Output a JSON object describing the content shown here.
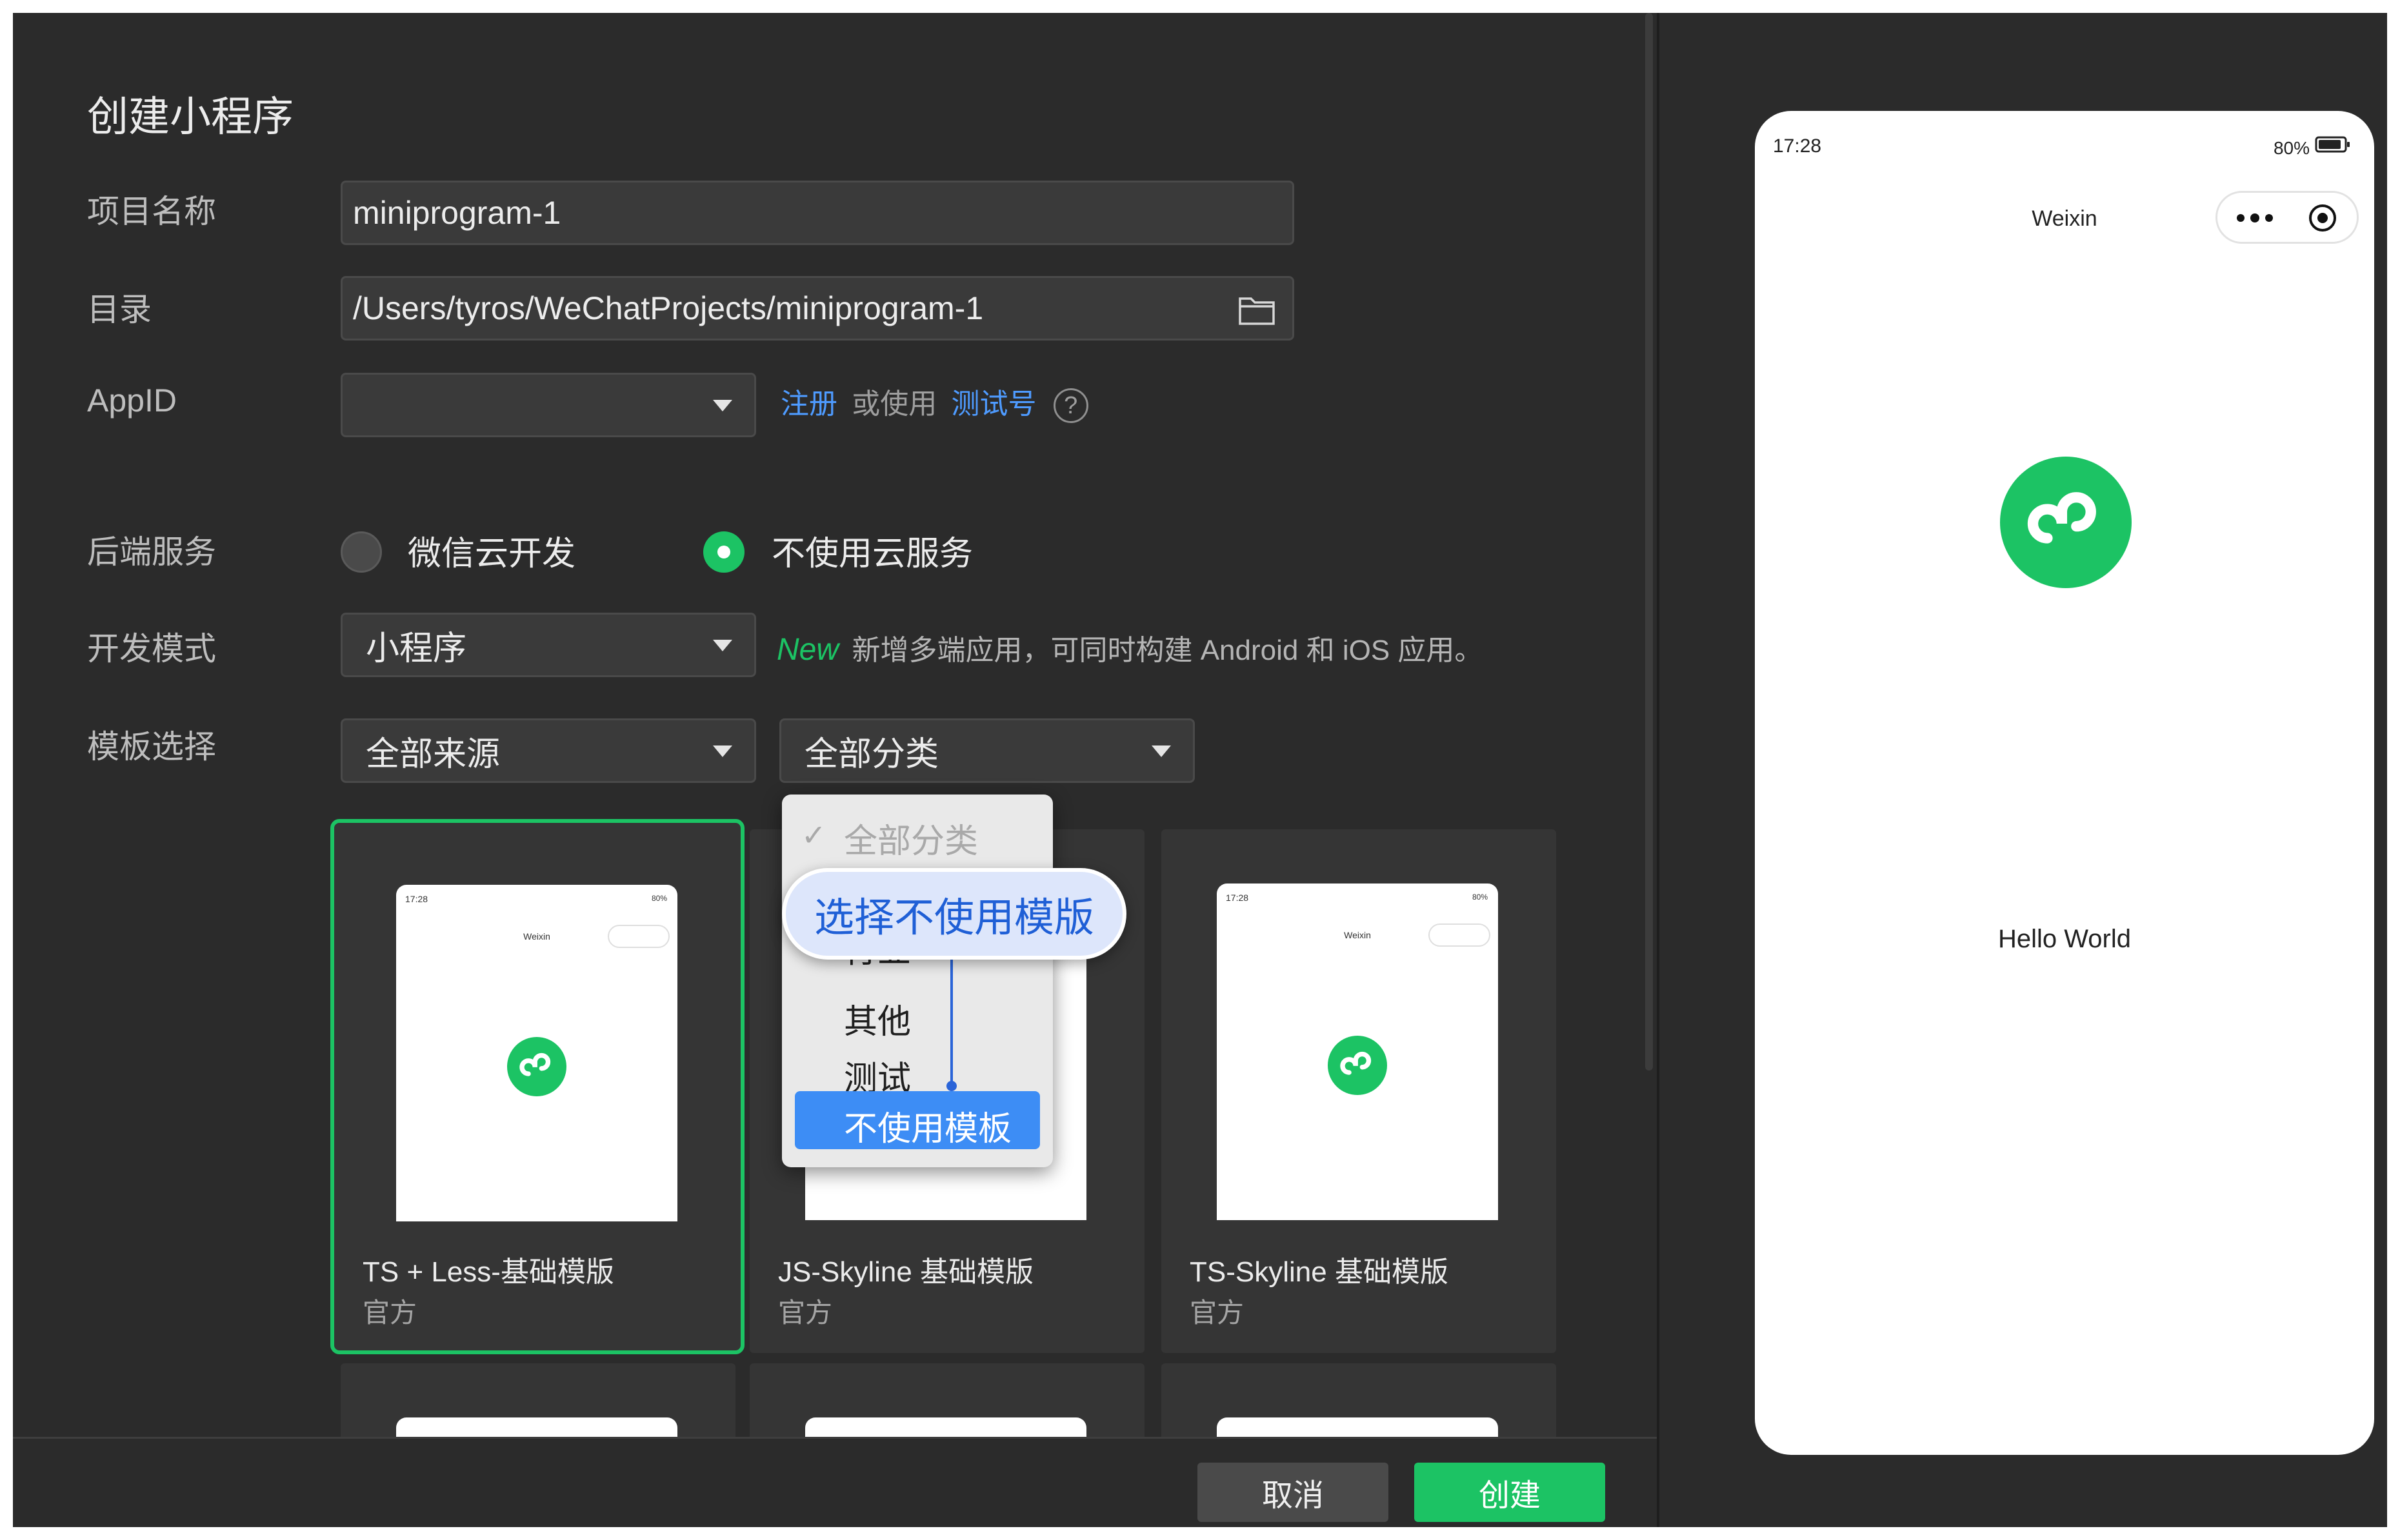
{
  "dialog": {
    "title": "创建小程序",
    "fields": {
      "project_name_label": "项目名称",
      "project_name_value": "miniprogram-1",
      "directory_label": "目录",
      "directory_value": "/Users/tyros/WeChatProjects/miniprogram-1",
      "appid_label": "AppID",
      "appid_value": "",
      "appid_register": "注册",
      "appid_or_use": "或使用",
      "appid_test": "测试号",
      "appid_help": "?",
      "backend_label": "后端服务",
      "backend_option_cloud": "微信云开发",
      "backend_option_none": "不使用云服务",
      "backend_selected": "不使用云服务",
      "dev_mode_label": "开发模式",
      "dev_mode_value": "小程序",
      "dev_mode_new": "New",
      "dev_mode_hint": "新增多端应用，可同时构建 Android 和 iOS 应用。",
      "template_label": "模板选择",
      "template_source": "全部来源",
      "template_category": "全部分类"
    }
  },
  "category_dropdown": {
    "items": [
      {
        "label": "全部分类",
        "checked": true,
        "disabled": true
      },
      {
        "label": "行业",
        "checked": false
      },
      {
        "label": "其他",
        "checked": false
      },
      {
        "label": "测试",
        "checked": false
      },
      {
        "label": "不使用模板",
        "checked": false,
        "highlighted": true
      }
    ]
  },
  "callout": {
    "text": "选择不使用模版"
  },
  "templates": [
    {
      "title": "TS + Less-基础模版",
      "source": "官方",
      "selected": true
    },
    {
      "title": "JS-Skyline 基础模版",
      "source": "官方",
      "selected": false
    },
    {
      "title": "TS-Skyline 基础模版",
      "source": "官方",
      "selected": false
    }
  ],
  "mini_preview": {
    "time": "17:28",
    "battery": "80%",
    "app_title": "Weixin"
  },
  "footer": {
    "cancel_label": "取消",
    "create_label": "创建"
  },
  "preview": {
    "status_time": "17:28",
    "battery": "80%",
    "app_title": "Weixin",
    "content_text": "Hello World"
  },
  "colors": {
    "accent_green": "#1cc364",
    "link_blue": "#4e9bff",
    "background": "#2b2b2b"
  },
  "icons": [
    "folder-icon",
    "chevron-down-icon",
    "help-icon",
    "miniprogram-logo-icon",
    "more-icon",
    "close-target-icon",
    "checkmark-icon",
    "battery-icon"
  ]
}
